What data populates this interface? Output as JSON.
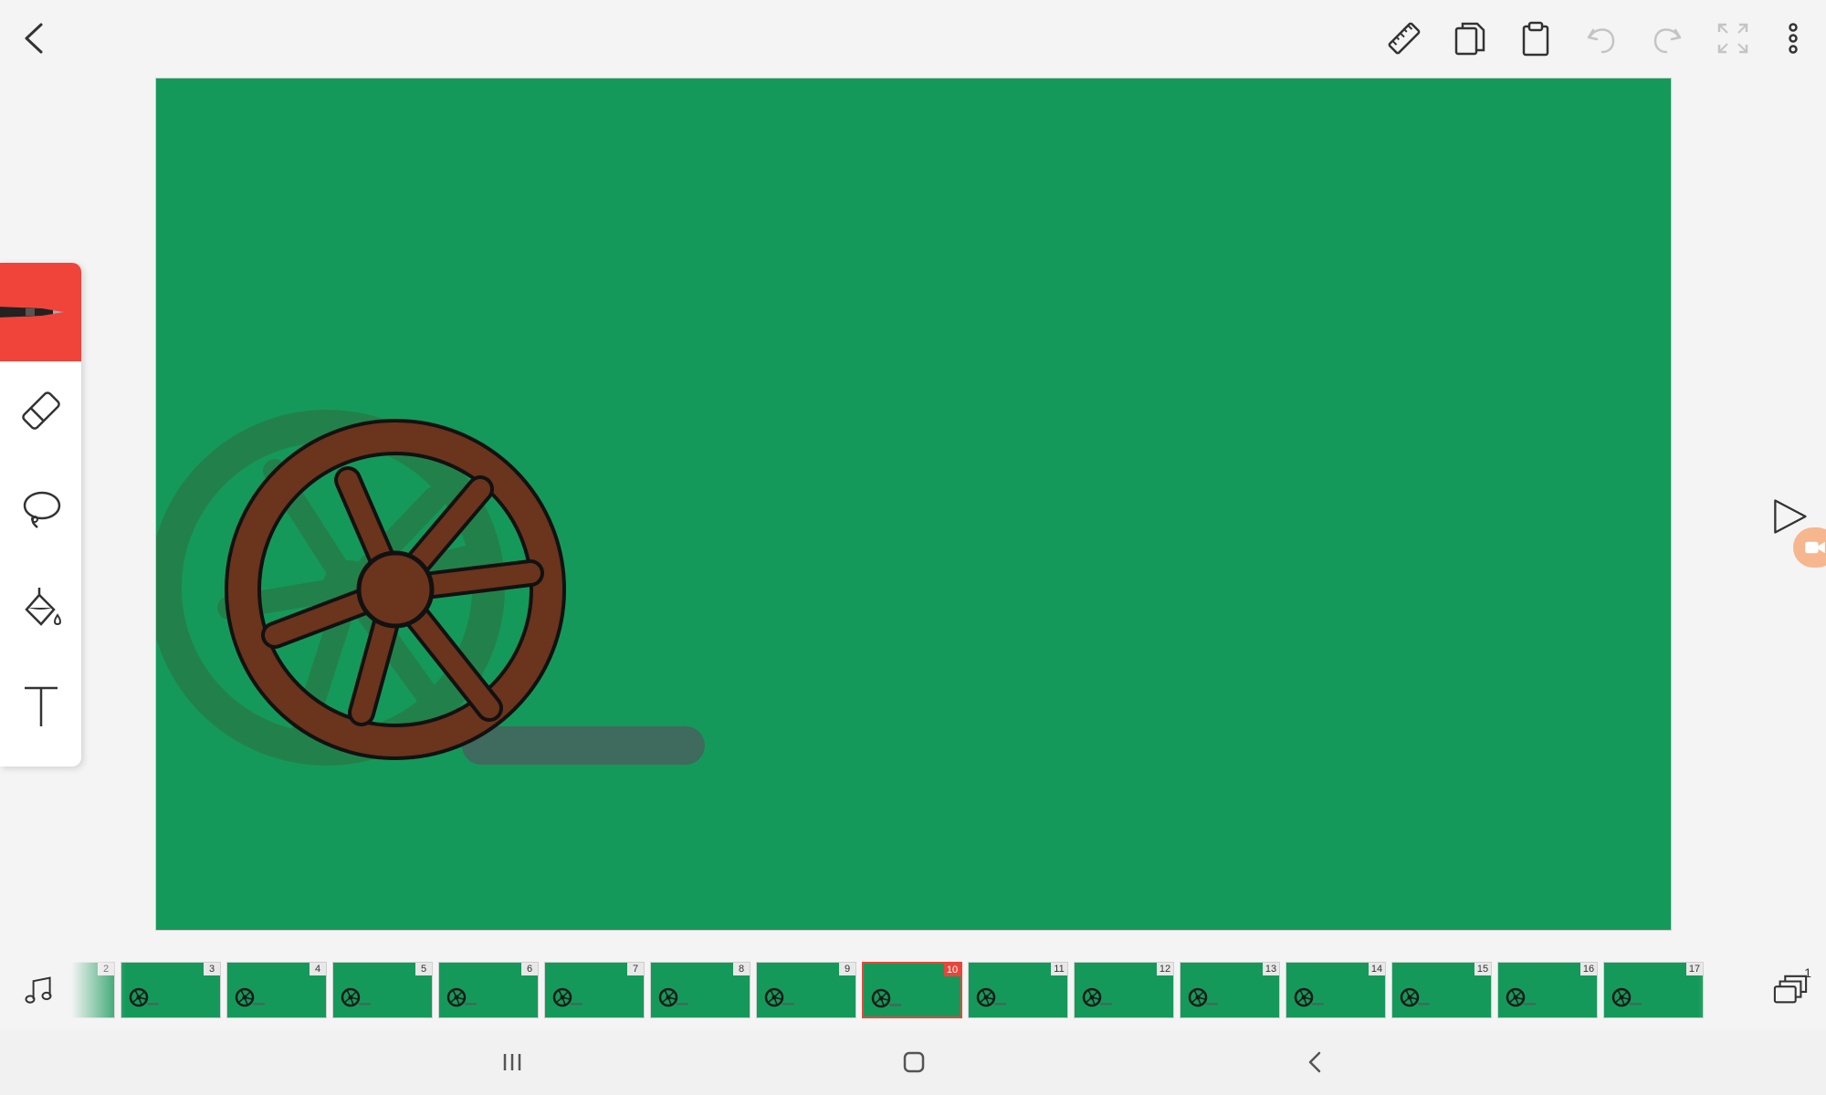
{
  "topbar": {
    "icons": [
      "back-arrow-icon",
      "ruler-icon",
      "copy-icon",
      "paste-clipboard-icon",
      "undo-icon",
      "redo-icon",
      "fullscreen-icon",
      "more-vert-icon"
    ]
  },
  "tools": [
    {
      "name": "pen",
      "icon": "pen-icon",
      "active": true
    },
    {
      "name": "eraser",
      "icon": "eraser-icon",
      "active": false
    },
    {
      "name": "lasso",
      "icon": "lasso-icon",
      "active": false
    },
    {
      "name": "fill",
      "icon": "paint-bucket-icon",
      "active": false
    },
    {
      "name": "text",
      "icon": "text-icon",
      "active": false
    }
  ],
  "colors": {
    "canvas": "#15995a",
    "accent": "#f0443a",
    "wheel": "#6b341c",
    "onion_skin": "#2e6e3d"
  },
  "timeline": {
    "frames": [
      "2",
      "3",
      "4",
      "5",
      "6",
      "7",
      "8",
      "9",
      "10",
      "11",
      "12",
      "13",
      "14",
      "15",
      "16",
      "17"
    ],
    "current_frame": "10",
    "layers_count": "1"
  },
  "navbar": {
    "icons": [
      "recent-apps-icon",
      "home-icon",
      "nav-back-icon"
    ]
  }
}
